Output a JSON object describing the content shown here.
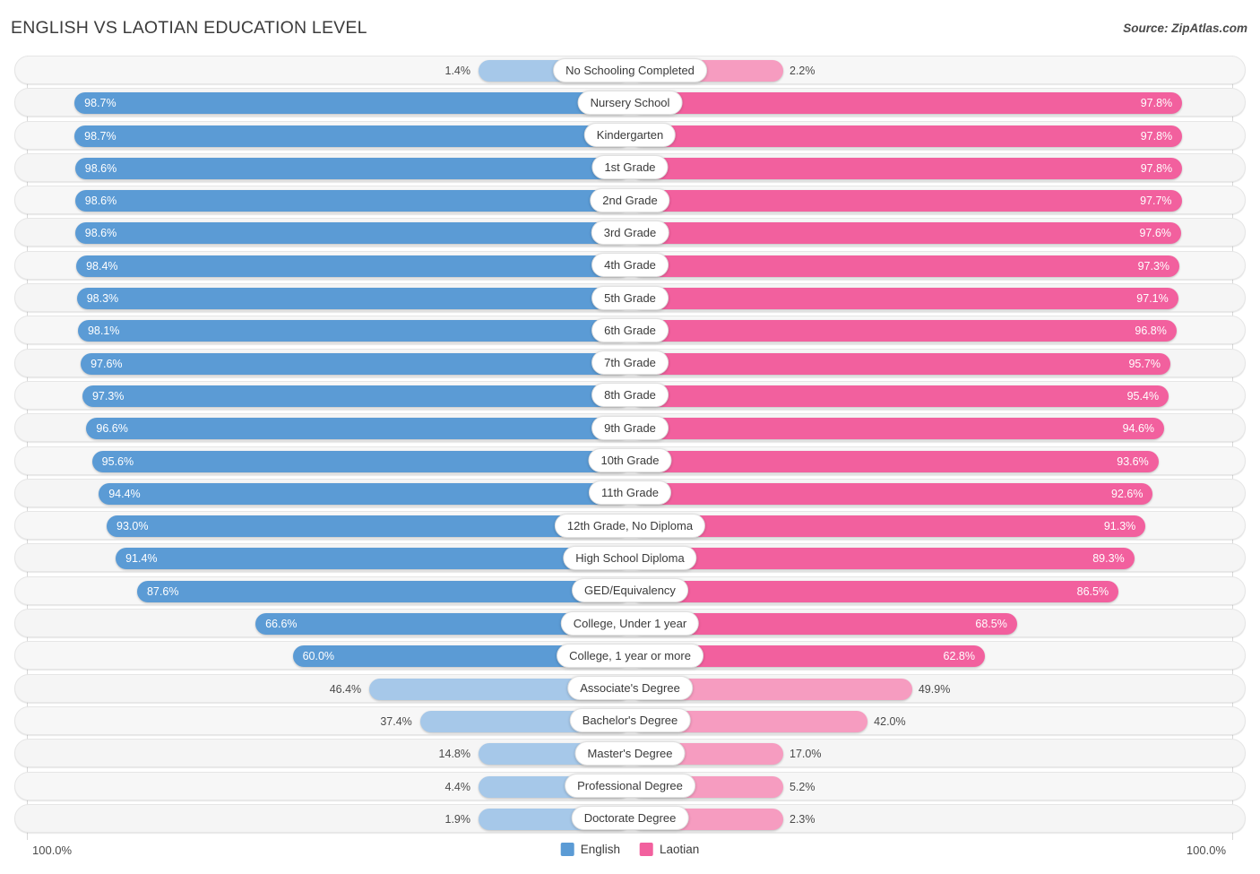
{
  "header": {
    "title": "ENGLISH VS LAOTIAN EDUCATION LEVEL",
    "source": "Source: ZipAtlas.com"
  },
  "axis": {
    "left_max_label": "100.0%",
    "right_max_label": "100.0%"
  },
  "legend": {
    "items": [
      {
        "label": "English",
        "color": "#5b9bd5"
      },
      {
        "label": "Laotian",
        "color": "#f2609e"
      }
    ]
  },
  "colors": {
    "english_strong": "#5b9bd5",
    "english_light": "#a6c8e9",
    "laotian_strong": "#f2609e",
    "laotian_light": "#f69cc0",
    "track": "#f7f7f7",
    "gridline": "#d8d8d8",
    "text": "#4a4a4a"
  },
  "chart_data": {
    "type": "bar",
    "title": "ENGLISH VS LAOTIAN EDUCATION LEVEL",
    "subtitle": "",
    "xlabel": "",
    "ylabel": "",
    "orientation": "horizontal-diverging",
    "xlim": [
      0,
      100
    ],
    "grid": true,
    "legend_position": "bottom-center",
    "categories": [
      "No Schooling Completed",
      "Nursery School",
      "Kindergarten",
      "1st Grade",
      "2nd Grade",
      "3rd Grade",
      "4th Grade",
      "5th Grade",
      "6th Grade",
      "7th Grade",
      "8th Grade",
      "9th Grade",
      "10th Grade",
      "11th Grade",
      "12th Grade, No Diploma",
      "High School Diploma",
      "GED/Equivalency",
      "College, Under 1 year",
      "College, 1 year or more",
      "Associate's Degree",
      "Bachelor's Degree",
      "Master's Degree",
      "Professional Degree",
      "Doctorate Degree"
    ],
    "series": [
      {
        "name": "English",
        "side": "left",
        "color": "#5b9bd5",
        "values": [
          1.4,
          98.7,
          98.7,
          98.6,
          98.6,
          98.6,
          98.4,
          98.3,
          98.1,
          97.6,
          97.3,
          96.6,
          95.6,
          94.4,
          93.0,
          91.4,
          87.6,
          66.6,
          60.0,
          46.4,
          37.4,
          14.8,
          4.4,
          1.9
        ],
        "labels": [
          "1.4%",
          "98.7%",
          "98.7%",
          "98.6%",
          "98.6%",
          "98.6%",
          "98.4%",
          "98.3%",
          "98.1%",
          "97.6%",
          "97.3%",
          "96.6%",
          "95.6%",
          "94.4%",
          "93.0%",
          "91.4%",
          "87.6%",
          "66.6%",
          "60.0%",
          "46.4%",
          "37.4%",
          "14.8%",
          "4.4%",
          "1.9%"
        ]
      },
      {
        "name": "Laotian",
        "side": "right",
        "color": "#f2609e",
        "values": [
          2.2,
          97.8,
          97.8,
          97.8,
          97.7,
          97.6,
          97.3,
          97.1,
          96.8,
          95.7,
          95.4,
          94.6,
          93.6,
          92.6,
          91.3,
          89.3,
          86.5,
          68.5,
          62.8,
          49.9,
          42.0,
          17.0,
          5.2,
          2.3
        ],
        "labels": [
          "2.2%",
          "97.8%",
          "97.8%",
          "97.8%",
          "97.7%",
          "97.6%",
          "97.3%",
          "97.1%",
          "96.8%",
          "95.7%",
          "95.4%",
          "94.6%",
          "93.6%",
          "92.6%",
          "91.3%",
          "89.3%",
          "86.5%",
          "68.5%",
          "62.8%",
          "49.9%",
          "42.0%",
          "17.0%",
          "5.2%",
          "2.3%"
        ]
      }
    ]
  }
}
